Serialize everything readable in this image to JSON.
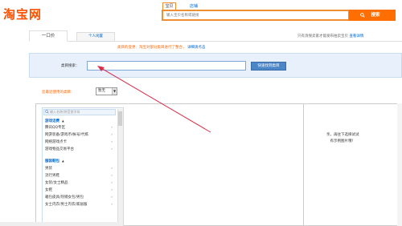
{
  "header": {
    "logo_text": "淘宝网",
    "search_tabs": [
      "宝贝",
      "店铺"
    ],
    "search_placeholder": "输入宝贝名称或链接",
    "search_button": "搜索"
  },
  "tabs": {
    "fixed_price": "一口价",
    "idle": "个人闲置",
    "note": "只有消保卖家才能发布拍卖宝贝",
    "note_link": "查看详情"
  },
  "notice": {
    "text": "类目的变更：淘宝对部分类目进行了整合，",
    "link": "详细请点击"
  },
  "category": {
    "label": "类目搜索：",
    "button": "快速找到类目"
  },
  "recent": {
    "label": "您最近使用的类目：",
    "selected": "暂无"
  },
  "list": {
    "search_placeholder": "输入名称/拼音首字母",
    "rows": [
      {
        "text": "游戏话费",
        "group": true
      },
      {
        "text": "腾讯QQ专区",
        "group": false
      },
      {
        "text": "网游装备/游戏币/帐号/代练",
        "group": false
      },
      {
        "text": "网络游戏点卡",
        "group": false
      },
      {
        "text": "游戏物品交易平台",
        "group": false
      },
      {
        "text": "服装鞋包",
        "group": true
      },
      {
        "text": "男装",
        "group": false
      },
      {
        "text": "流行男鞋",
        "group": false
      },
      {
        "text": "女装/女士精品",
        "group": false
      },
      {
        "text": "女鞋",
        "group": false
      },
      {
        "text": "箱包皮具/热销女包/男包",
        "group": false
      },
      {
        "text": "女士内衣/男士内衣/家居服",
        "group": false
      }
    ]
  },
  "tip": {
    "line1": "亲，再往下选择试试",
    "line2": "有示例图片哦！"
  },
  "colors": {
    "brand": "#ff5000",
    "search_button": "#ff6e00",
    "link": "#0066cc",
    "panel_bg": "#e8f1fb",
    "arrow": "#d9304a"
  }
}
